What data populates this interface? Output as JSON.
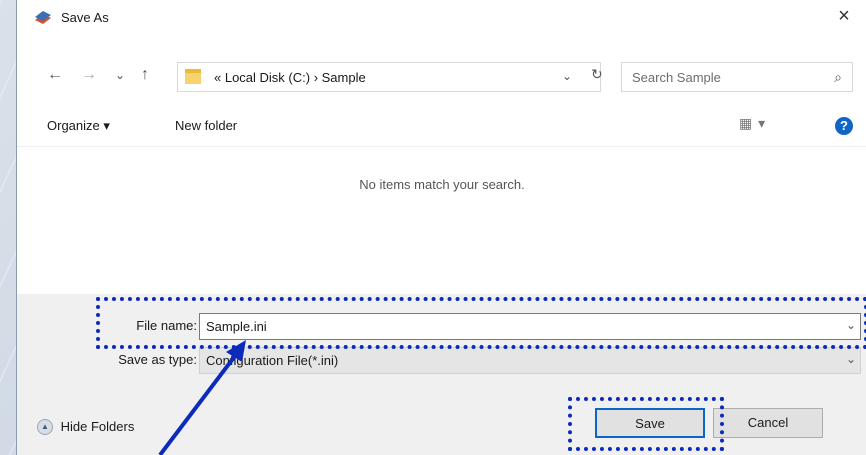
{
  "window": {
    "title": "Save As",
    "close_glyph": "×"
  },
  "nav": {
    "back_glyph": "←",
    "forward_glyph": "→",
    "recent_glyph": "⌄",
    "up_glyph": "↑",
    "breadcrumb": "« Local Disk (C:) › Sample",
    "address_dropdown_glyph": "⌄",
    "refresh_glyph": "↻",
    "search_placeholder": "Search Sample",
    "search_icon_glyph": "⌕"
  },
  "toolbar": {
    "organize_label": "Organize ▾",
    "new_folder_label": "New folder",
    "views_glyph": "▦ ▾",
    "help_glyph": "?"
  },
  "content": {
    "empty_message": "No items match your search."
  },
  "form": {
    "file_name_label": "File name:",
    "file_name_value": "Sample.ini",
    "save_type_label": "Save as type:",
    "save_type_value": "Configuration File(*.ini)",
    "dropdown_glyph": "⌄"
  },
  "footer": {
    "hide_folders_label": "Hide Folders",
    "hide_folders_glyph": "▲",
    "save_label": "Save",
    "cancel_label": "Cancel"
  },
  "annotation_color": "#0d2bbb",
  "accent_color": "#0a66c8"
}
